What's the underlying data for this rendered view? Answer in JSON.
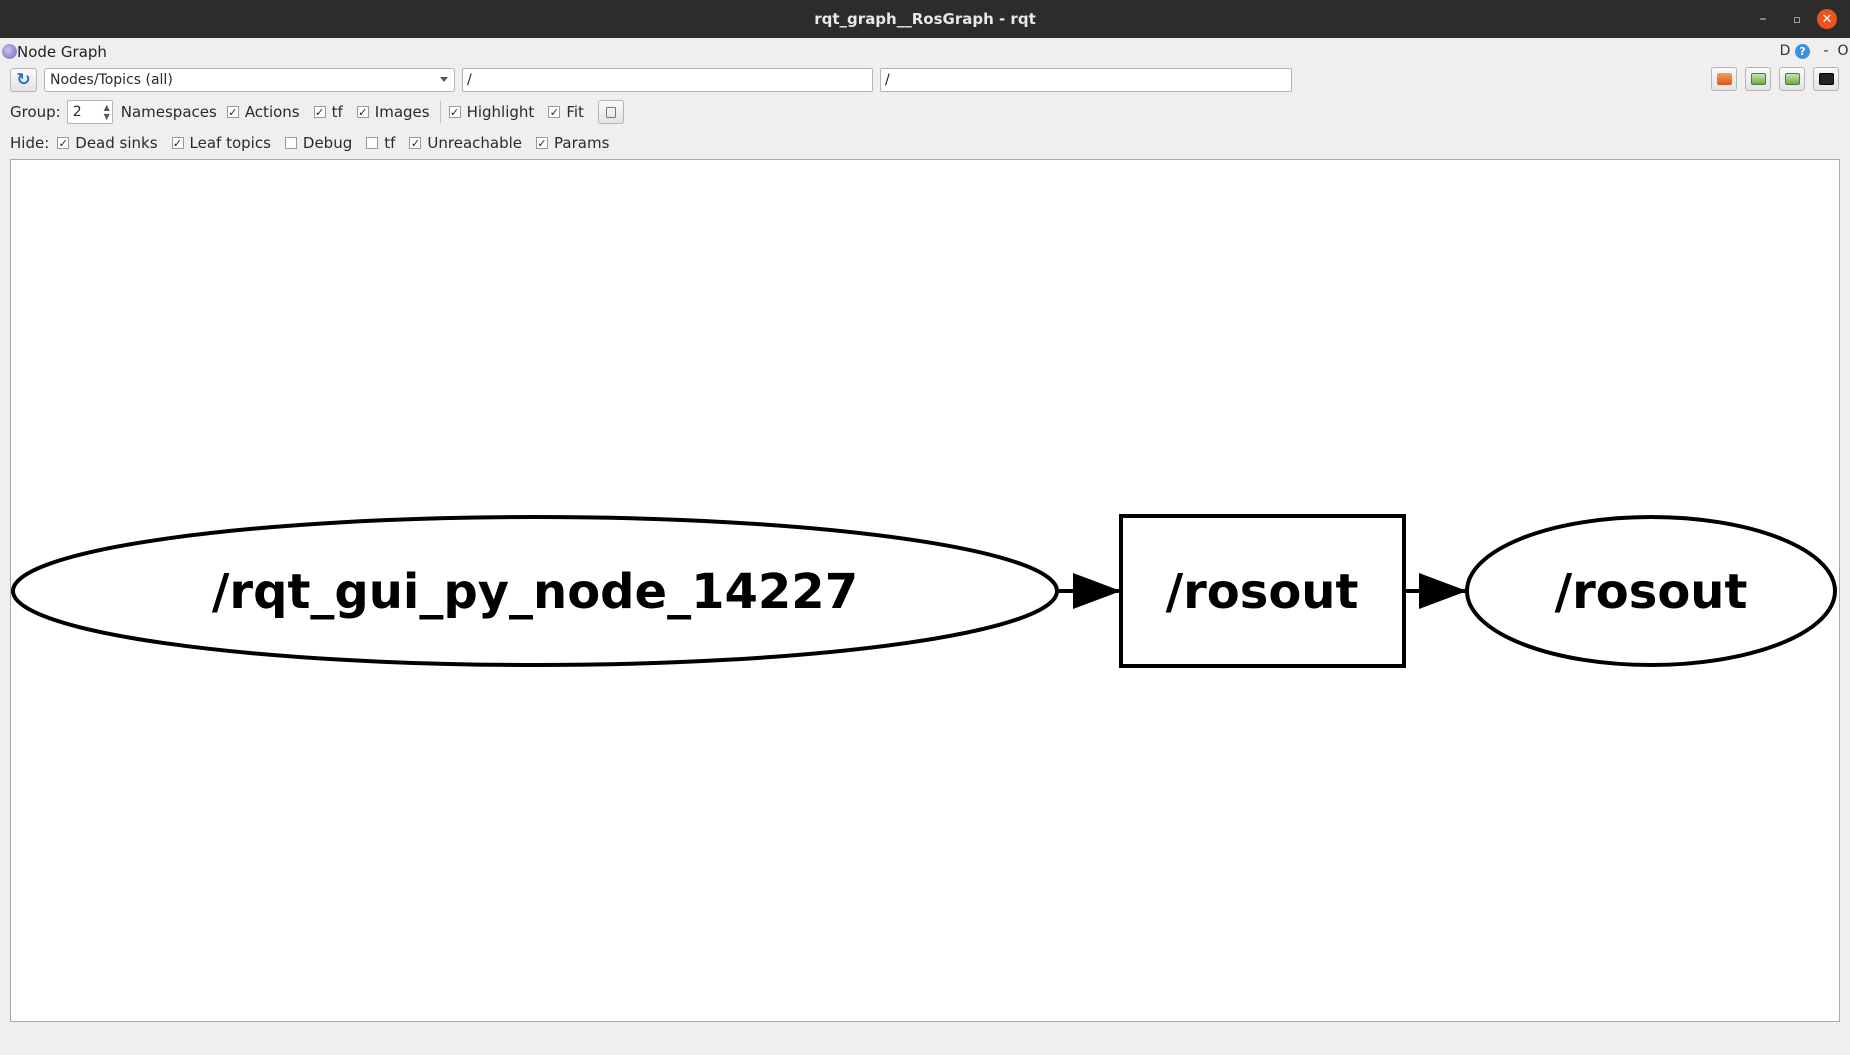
{
  "window": {
    "title": "rqt_graph__RosGraph - rqt",
    "minimize_glyph": "–",
    "maximize_glyph": "▫",
    "close_glyph": "✕"
  },
  "plugin": {
    "title": "Node Graph",
    "icon": "rqt-plugin-icon",
    "dock_buttons": {
      "d": "D",
      "help": "?",
      "minimize": "-",
      "close": "O"
    }
  },
  "toolbar": {
    "refresh_icon": "refresh-icon",
    "refresh_glyph": "↻",
    "mode_select": "Nodes/Topics (all)",
    "node_filter": "/",
    "topic_filter": "/",
    "buttons": [
      "load-dot-icon",
      "save-dot-icon",
      "save-svg-icon",
      "save-image-icon"
    ]
  },
  "options": {
    "group_label": "Group:",
    "group_value": "2",
    "namespaces_label": "Namespaces",
    "checkboxes": [
      {
        "label": "Actions",
        "checked": true
      },
      {
        "label": "tf",
        "checked": true
      },
      {
        "label": "Images",
        "checked": true
      },
      {
        "label": "Highlight",
        "checked": true
      },
      {
        "label": "Fit",
        "checked": true
      }
    ]
  },
  "hide": {
    "label": "Hide:",
    "checkboxes": [
      {
        "label": "Dead sinks",
        "checked": true
      },
      {
        "label": "Leaf topics",
        "checked": true
      },
      {
        "label": "Debug",
        "checked": false
      },
      {
        "label": "tf",
        "checked": false
      },
      {
        "label": "Unreachable",
        "checked": true
      },
      {
        "label": "Params",
        "checked": true
      }
    ]
  },
  "graph": {
    "nodes": [
      {
        "label": "/rqt_gui_py_node_14227",
        "shape": "ellipse"
      },
      {
        "label": "/rosout",
        "shape": "box"
      },
      {
        "label": "/rosout",
        "shape": "ellipse"
      }
    ],
    "edges": [
      {
        "from": 0,
        "to": 1
      },
      {
        "from": 1,
        "to": 2
      }
    ]
  },
  "colors": {
    "titlebar": "#2c2c2c",
    "close_button": "#e95420",
    "help_button": "#3d8fe0"
  }
}
